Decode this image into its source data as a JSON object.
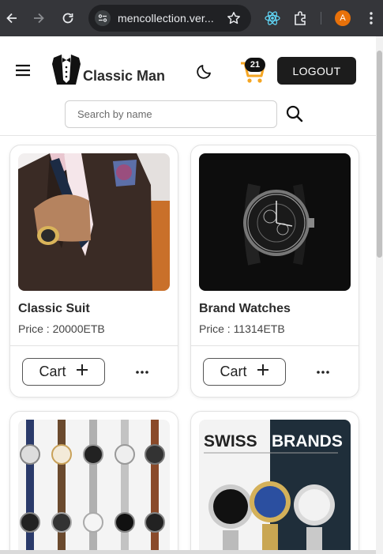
{
  "browser": {
    "url": "mencollection.ver...",
    "avatar_letter": "A"
  },
  "header": {
    "brand": "Classic Man",
    "cart_count": "21",
    "logout_label": "LOGOUT",
    "search_placeholder": "Search by name"
  },
  "products": [
    {
      "title": "Classic Suit",
      "price": "Price : 20000ETB",
      "cart_label": "Cart",
      "image": "suit-photo"
    },
    {
      "title": "Brand Watches",
      "price": "Price : 11314ETB",
      "cart_label": "Cart",
      "image": "watch-photo"
    },
    {
      "title": "",
      "price": "",
      "cart_label": "",
      "image": "watch-grid-photo"
    },
    {
      "title": "",
      "price": "",
      "cart_label": "",
      "image": "swiss-brands-photo",
      "banner_text_left": "SWISS",
      "banner_text_right": "BRANDS"
    }
  ],
  "colors": {
    "accent": "#1c1c1c",
    "cart_orange": "#f5a623",
    "browser_bg": "#35363a"
  }
}
